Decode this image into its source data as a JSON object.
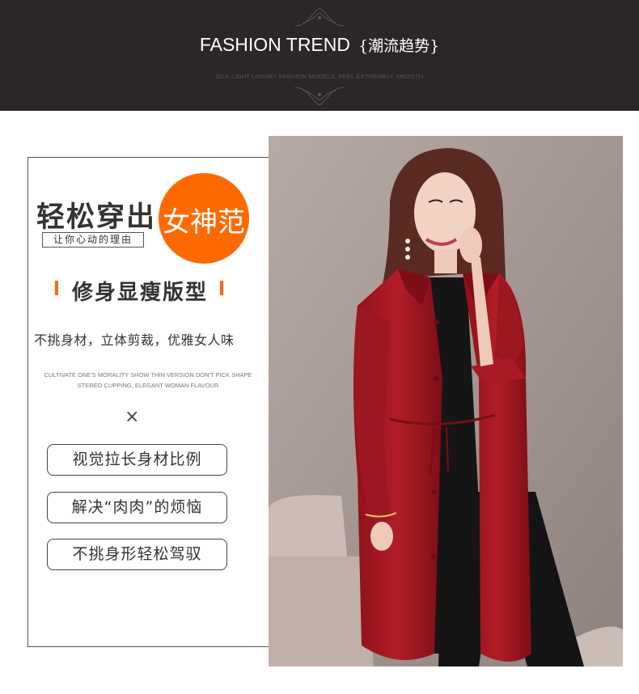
{
  "banner": {
    "title": "FASHION TREND",
    "title_cn": "{潮流趋势}",
    "subtitle": "SILK LIGHT LUXURY FASHION MODELS, FEEL EXTREMELY SMOOTH"
  },
  "card": {
    "headline": "轻松穿出",
    "badge": "女神范",
    "tagline": "让你心动的理由",
    "section_title": "修身显瘦版型",
    "description": "不挑身材，立体剪裁，优雅女人味",
    "english_line1": "CULTIVATE ONE'S MORALITY SHOW THIN VERSION DON'T PICK SHAPE",
    "english_line2": "STEREO CUPPING, ELEGANT WOMAN FLAVOUR",
    "separator": "×",
    "features": [
      "视觉拉长身材比例",
      "解决“肉肉”的烦恼",
      "不挑身形轻松驾驭"
    ]
  },
  "colors": {
    "banner_bg": "#2b2627",
    "accent": "#ff6a00",
    "coat": "#a3161f"
  }
}
